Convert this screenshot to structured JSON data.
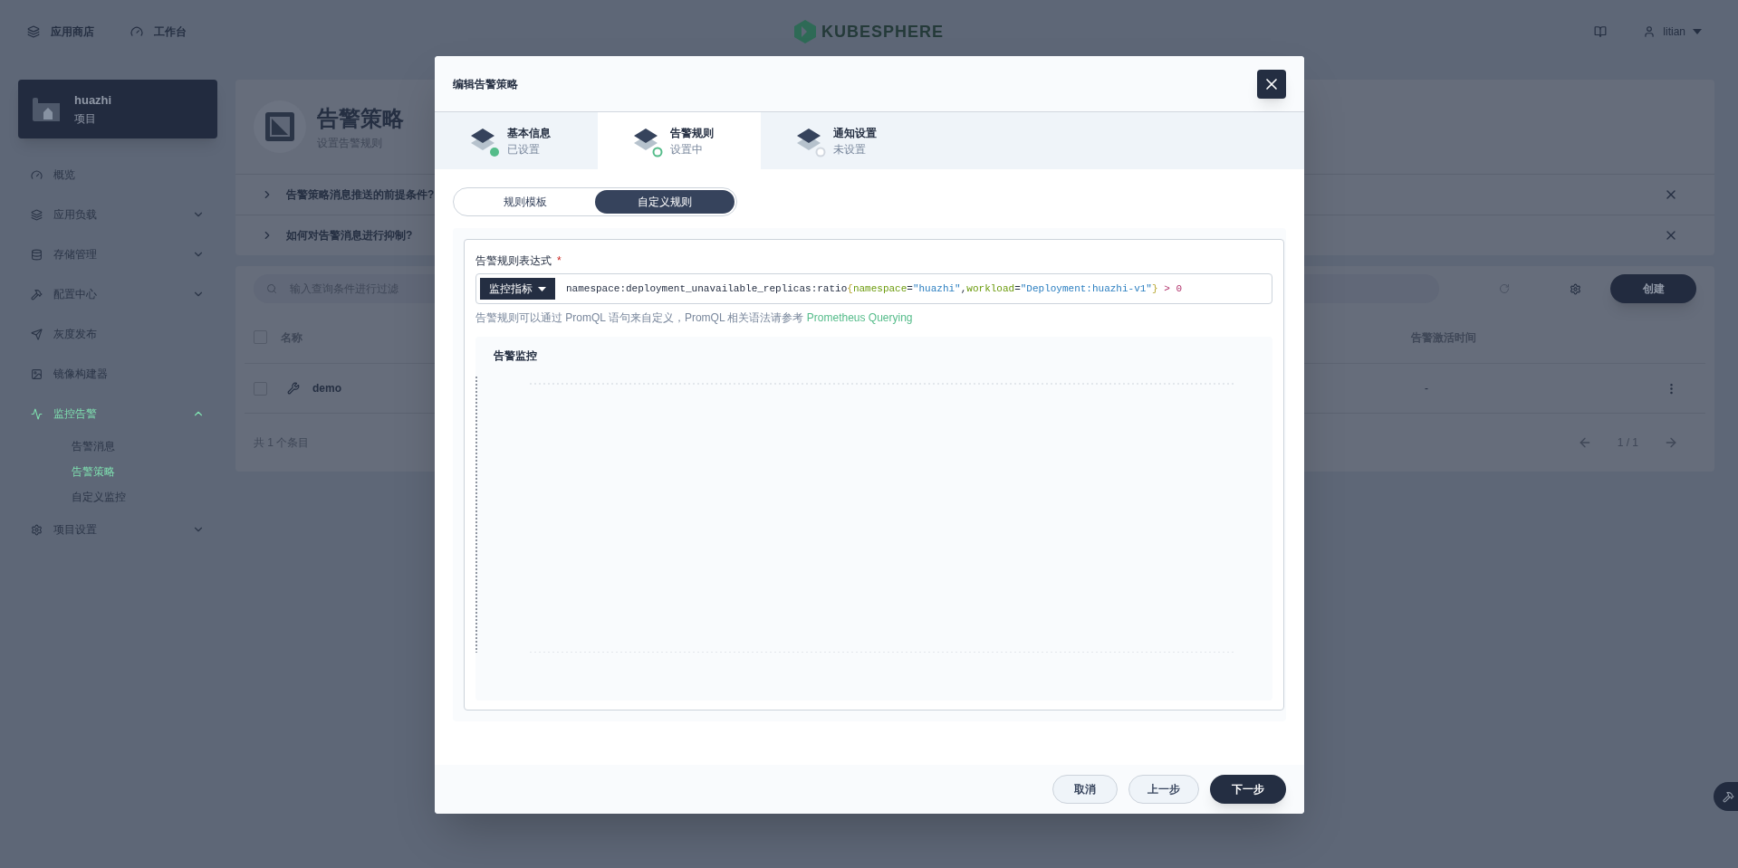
{
  "top_bar": {
    "nav": [
      {
        "label": "应用商店"
      },
      {
        "label": "工作台"
      }
    ],
    "logo": "KUBESPHERE",
    "user": "litian"
  },
  "sidebar": {
    "project": {
      "name": "huazhi",
      "type": "项目"
    },
    "items": [
      {
        "label": "概览",
        "selected": false
      },
      {
        "label": "应用负载",
        "expandable": true,
        "expanded": false,
        "selected": false
      },
      {
        "label": "存储管理",
        "expandable": true,
        "expanded": false,
        "selected": false
      },
      {
        "label": "配置中心",
        "expandable": true,
        "expanded": false,
        "selected": false
      },
      {
        "label": "灰度发布",
        "selected": false
      },
      {
        "label": "镜像构建器",
        "selected": false
      },
      {
        "label": "监控告警",
        "expandable": true,
        "expanded": true,
        "selected": true,
        "children": [
          {
            "label": "告警消息",
            "selected": false
          },
          {
            "label": "告警策略",
            "selected": true
          },
          {
            "label": "自定义监控",
            "selected": false
          }
        ]
      },
      {
        "label": "项目设置",
        "expandable": true,
        "expanded": false,
        "selected": false
      }
    ]
  },
  "page_header": {
    "title": "告警策略",
    "subtitle": "设置告警规则"
  },
  "faq": [
    {
      "question": "告警策略消息推送的前提条件?"
    },
    {
      "question": "如何对告警消息进行抑制?"
    }
  ],
  "list": {
    "search": {
      "placeholder": "输入查询条件进行过滤"
    },
    "create_button": "创建",
    "columns": [
      "名称",
      "告警激活时间"
    ],
    "header_checked": false,
    "rows": [
      {
        "name": "demo",
        "activated": "-",
        "checked": false
      }
    ],
    "total": "共 1 个条目",
    "page": "1 / 1"
  },
  "modal": {
    "title": "编辑告警策略",
    "steps": [
      {
        "title": "基本信息",
        "status": "已设置",
        "kind": "done",
        "selected": false
      },
      {
        "title": "告警规则",
        "status": "设置中",
        "kind": "current",
        "selected": true
      },
      {
        "title": "通知设置",
        "status": "未设置",
        "kind": "pending",
        "selected": false
      }
    ],
    "modes": [
      {
        "label": "规则模板",
        "selected": false
      },
      {
        "label": "自定义规则",
        "selected": true
      }
    ],
    "expression_label": "告警规则表达式",
    "required_mark": "*",
    "metric_button": "监控指标",
    "expression": [
      {
        "text": "namespace:deployment_unavailable_replicas:ratio",
        "kind": "plain"
      },
      {
        "text": "{",
        "kind": "brace"
      },
      {
        "text": "namespace",
        "kind": "label"
      },
      {
        "text": "=",
        "kind": "plain"
      },
      {
        "text": "\"huazhi\"",
        "kind": "string"
      },
      {
        "text": ",",
        "kind": "plain"
      },
      {
        "text": "workload",
        "kind": "label"
      },
      {
        "text": "=",
        "kind": "plain"
      },
      {
        "text": "\"Deployment:huazhi-v1\"",
        "kind": "string"
      },
      {
        "text": "}",
        "kind": "brace"
      },
      {
        "text": " > ",
        "kind": "operator"
      },
      {
        "text": "0",
        "kind": "number"
      }
    ],
    "hint": "告警规则可以通过 PromQL 语句来自定义，PromQL 相关语法请参考",
    "hint_link": "Prometheus Querying",
    "chart_title": "告警监控",
    "buttons": [
      {
        "label": "取消",
        "kind": "secondary"
      },
      {
        "label": "上一步",
        "kind": "secondary"
      },
      {
        "label": "下一步",
        "kind": "primary"
      }
    ]
  }
}
